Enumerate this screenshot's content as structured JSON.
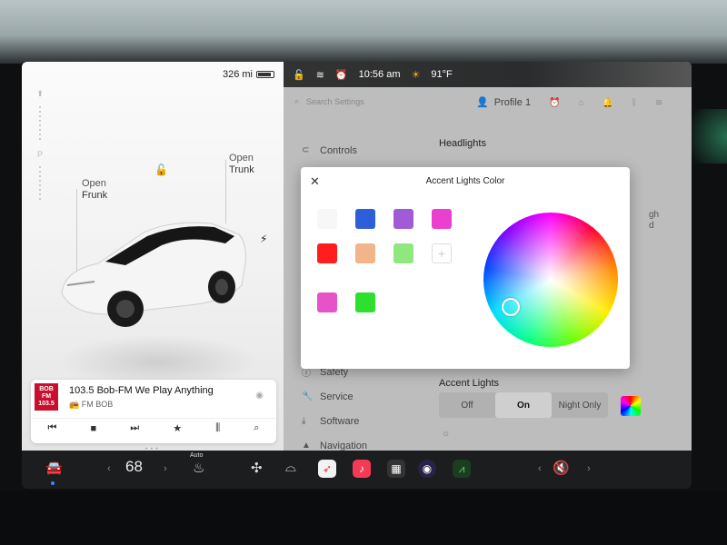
{
  "status": {
    "range": "326 mi",
    "time": "10:56 am",
    "temperature": "91°F"
  },
  "car_view": {
    "gear_p": "P",
    "frunk": {
      "open": "Open",
      "label": "Frunk"
    },
    "trunk": {
      "open": "Open",
      "label": "Trunk"
    }
  },
  "media": {
    "logo_line1": "BOB",
    "logo_line2": "FM",
    "logo_line3": "103.5",
    "title": "103.5 Bob-FM We Play Anything",
    "source": "FM BOB"
  },
  "settings": {
    "search_placeholder": "Search Settings",
    "profile": "Profile 1",
    "menu": [
      "Controls",
      "Safety",
      "Service",
      "Software",
      "Navigation"
    ],
    "headlights_label": "Headlights",
    "accent_lights_label": "Accent Lights",
    "accent_options": [
      "Off",
      "On",
      "Night Only"
    ],
    "accent_selected": "On",
    "side_hint_1": "gh",
    "side_hint_2": "d"
  },
  "modal": {
    "title": "Accent Lights Color",
    "swatches": [
      {
        "color": "#f7f7f7"
      },
      {
        "color": "#2f5fd8"
      },
      {
        "color": "#a25bd6"
      },
      {
        "color": "#ea3fcf"
      },
      {
        "color": "#ff1e1e"
      },
      {
        "color": "#f2b58a"
      },
      {
        "color": "#8fe87e"
      },
      {
        "color": "add"
      },
      {
        "color": "#e852c9"
      },
      {
        "color": "#2ee02e"
      }
    ],
    "selected_hue_position": "bottom-left"
  },
  "dock": {
    "temperature": "68",
    "seat_heat_label": "Auto"
  }
}
